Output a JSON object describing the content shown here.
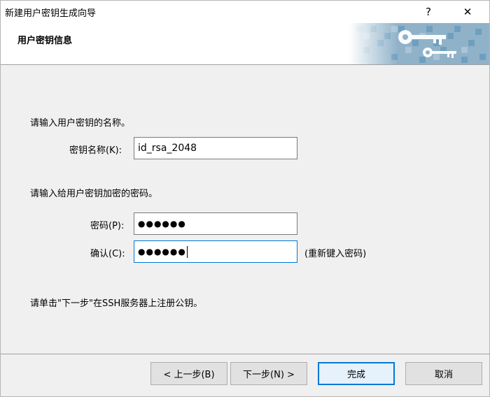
{
  "window": {
    "title": "新建用户密钥生成向导",
    "help_label": "?",
    "close_label": "✕"
  },
  "header": {
    "title": "用户密钥信息"
  },
  "key_section": {
    "instruction": "请输入用户密钥的名称。",
    "name_label": "密钥名称(K):",
    "name_value": "id_rsa_2048"
  },
  "password_section": {
    "instruction": "请输入给用户密钥加密的密码。",
    "password_label": "密码(P):",
    "password_value": "●●●●●●",
    "confirm_label": "确认(C):",
    "confirm_value": "●●●●●●",
    "confirm_hint": "(重新键入密码)"
  },
  "footer_note": "请单击\"下一步\"在SSH服务器上注册公钥。",
  "buttons": {
    "back": "< 上一步(B)",
    "next": "下一步(N) >",
    "finish": "完成",
    "cancel": "取消"
  },
  "colors": {
    "focus_border": "#0078d7",
    "banner_blue": "#6f9fbf"
  }
}
